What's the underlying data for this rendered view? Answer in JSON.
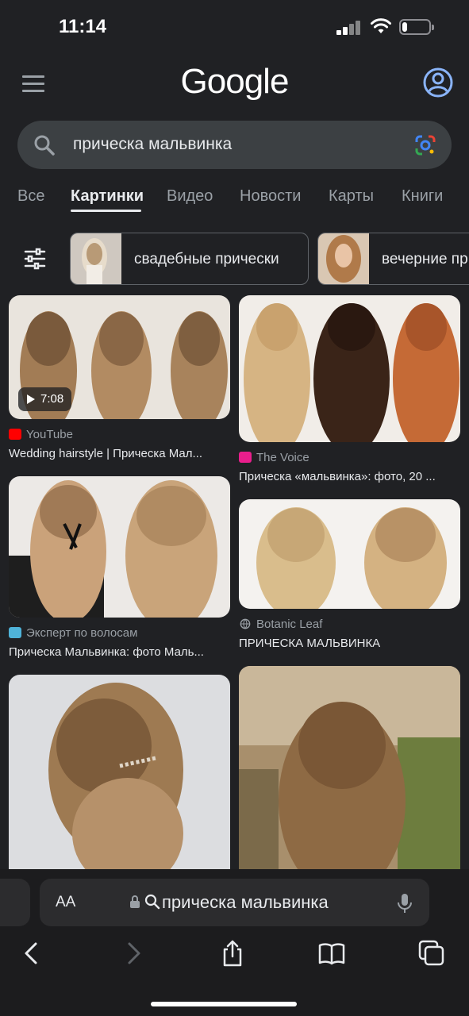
{
  "status_bar": {
    "time": "11:14",
    "battery_level": 0.2
  },
  "header": {
    "logo_text": "Google",
    "menu_icon": "hamburger-menu-icon",
    "account_icon": "account-circle-icon"
  },
  "search": {
    "query": "прическа мальвинка",
    "search_icon": "search-icon",
    "lens_icon": "google-lens-icon"
  },
  "tabs": [
    {
      "label": "Все",
      "active": false
    },
    {
      "label": "Картинки",
      "active": true
    },
    {
      "label": "Видео",
      "active": false
    },
    {
      "label": "Новости",
      "active": false
    },
    {
      "label": "Карты",
      "active": false
    },
    {
      "label": "Книги",
      "active": false
    }
  ],
  "chips": [
    {
      "label": "свадебные прически"
    },
    {
      "label": "вечерние пр"
    }
  ],
  "results": [
    {
      "source": "YouTube",
      "source_color": "#ff0000",
      "title": "Wedding hairstyle | Прическа Мал...",
      "duration": "7:08"
    },
    {
      "source": "The Voice",
      "source_color": "#e91e8c",
      "title": "Прическа «мальвинка»: фото, 20 ..."
    },
    {
      "source": "Эксперт по волосам",
      "source_color": "#4fb3d9",
      "title": "Прическа Мальвинка: фото Маль..."
    },
    {
      "source": "Botanic Leaf",
      "source_color": "#9aa0a6",
      "title": "ПРИЧЕСКА МАЛЬВИНКА"
    }
  ],
  "safari": {
    "text_size_label": "AA",
    "address_text": "прическа мальвинка"
  },
  "colors": {
    "background": "#202124",
    "surface": "#3c4043",
    "accent": "#8ab4f8",
    "text": "#e8eaed",
    "muted": "#9aa0a6"
  }
}
